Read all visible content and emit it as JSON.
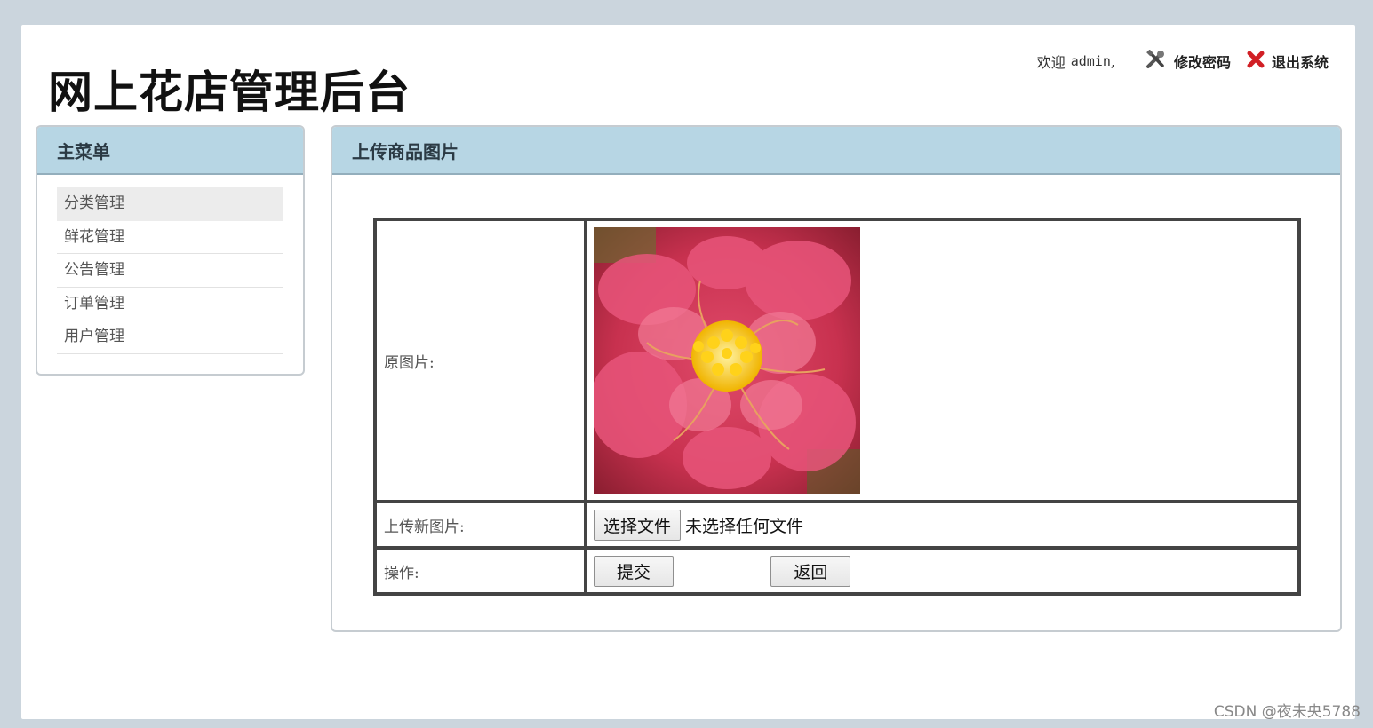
{
  "header": {
    "title": "网上花店管理后台",
    "welcome": "欢迎",
    "username": "admin",
    "comma": ",",
    "change_password": "修改密码",
    "logout": "退出系统"
  },
  "sidebar": {
    "title": "主菜单",
    "items": [
      {
        "label": "分类管理"
      },
      {
        "label": "鲜花管理"
      },
      {
        "label": "公告管理"
      },
      {
        "label": "订单管理"
      },
      {
        "label": "用户管理"
      }
    ]
  },
  "main": {
    "title": "上传商品图片",
    "form": {
      "original_label": "原图片:",
      "upload_label": "上传新图片:",
      "file_button": "选择文件",
      "file_status": "未选择任何文件",
      "action_label": "操作:",
      "submit": "提交",
      "back": "返回"
    }
  },
  "watermark": "CSDN @夜未央5788",
  "colors": {
    "panel_header": "#b7d6e4",
    "background": "#cbd5dd",
    "logout_icon": "#d11f25"
  }
}
